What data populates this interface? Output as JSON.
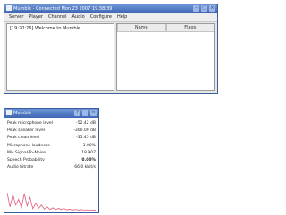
{
  "main_window": {
    "title": "Mumble - Connected Mon 23 2007 19:38:39",
    "controls": [
      "–",
      "▢",
      "×"
    ],
    "menu": [
      "Server",
      "Player",
      "Channel",
      "Audio",
      "Configure",
      "Help"
    ],
    "log_line": "[19:20:26] Welcome to Mumble.",
    "columns": [
      "Name",
      "Flags"
    ]
  },
  "stats_window": {
    "title": "Mumble",
    "controls": [
      "?",
      "–",
      "×"
    ],
    "rows": [
      {
        "label": "Peak microphone level",
        "value": "-52.42 dB"
      },
      {
        "label": "Peak speaker level",
        "value": "-300.00 dB"
      },
      {
        "label": "Peak clean level",
        "value": "-35.45 dB"
      },
      {
        "label": "Microphone loudness",
        "value": "1.00%"
      },
      {
        "label": "Mic Signal-To-Noise",
        "value": "18.907"
      },
      {
        "label": "Speech Probability",
        "value": "0.00%"
      },
      {
        "label": "Audio bitrate",
        "value": "66.0 kbit/s"
      }
    ],
    "graph": {
      "color": "#e05a7a",
      "levels": [
        0.95,
        0.2,
        0.85,
        0.3,
        0.6,
        0.15,
        0.9,
        0.25,
        0.7,
        0.1,
        0.4,
        0.12,
        0.3,
        0.08,
        0.2,
        0.06,
        0.15,
        0.05,
        0.12,
        0.05,
        0.1,
        0.04,
        0.08,
        0.04,
        0.06,
        0.03,
        0.05,
        0.03,
        0.04,
        0.03,
        0.03,
        0.02
      ]
    }
  }
}
